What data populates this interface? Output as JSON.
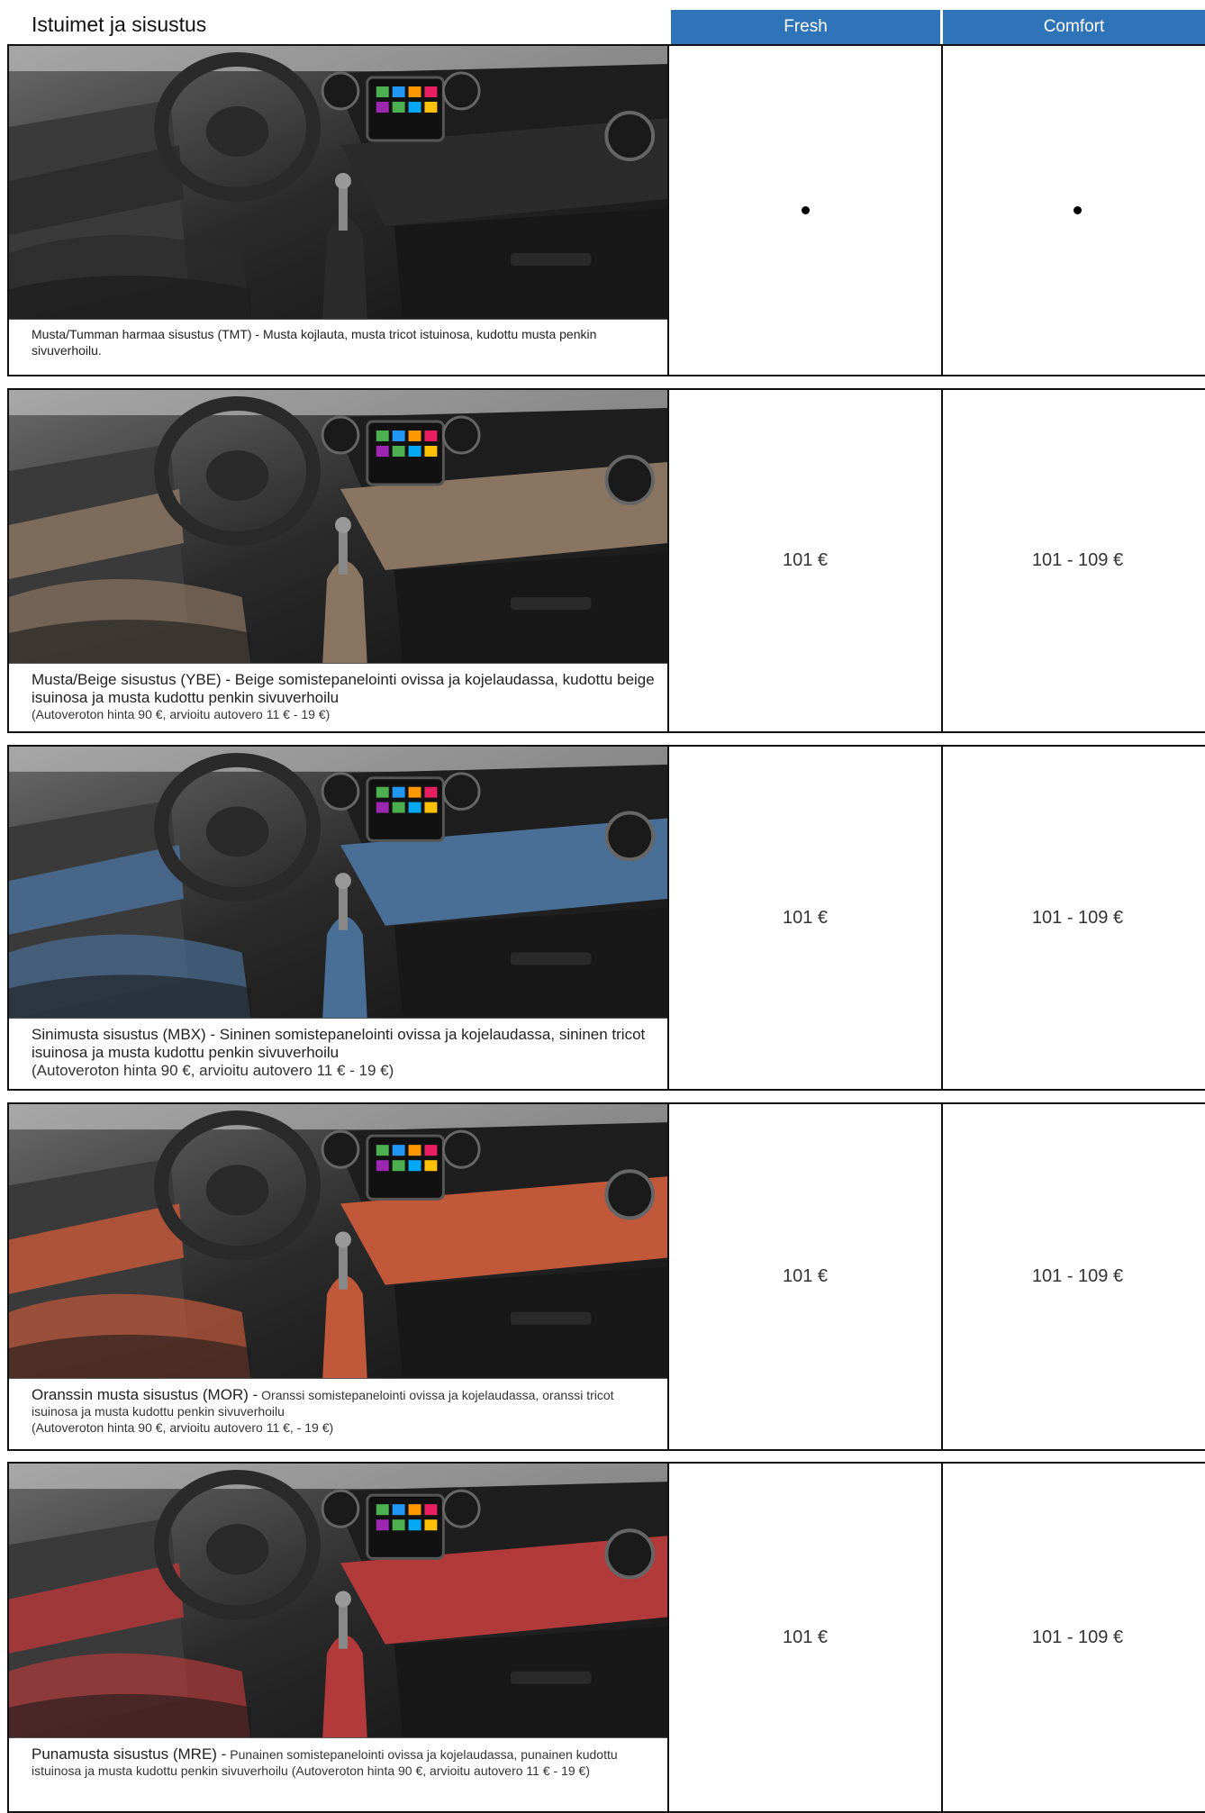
{
  "header": {
    "title": "Istuimet ja sisustus",
    "columns": [
      "Fresh",
      "Comfort"
    ]
  },
  "rows": [
    {
      "accent": "#2b2b2b",
      "desc_main": "Musta/Tumman harmaa sisustus (TMT) - Musta kojlauta, musta tricot istuinosa, kudottu musta penkin sivuverhoilu.",
      "desc_rest": "",
      "desc_note": "",
      "fresh": "",
      "comfort": "",
      "standard": true
    },
    {
      "accent": "#8a7563",
      "desc_main": "Musta/Beige sisustus (YBE) - Beige somistepanelointi ovissa ja kojelaudassa, kudottu beige isuinosa ja musta kudottu penkin sivuverhoilu",
      "desc_rest": "",
      "desc_note": "(Autoveroton hinta 90 €, arvioitu autovero 11 € - 19 €)",
      "fresh": "101 €",
      "comfort": "101 - 109 €",
      "standard": false
    },
    {
      "accent": "#4a6f96",
      "desc_main": "Sinimusta sisustus (MBX) - Sininen somistepanelointi ovissa ja kojelaudassa, sininen tricot isuinosa ja musta kudottu penkin sivuverhoilu",
      "desc_rest": "",
      "desc_note": "(Autoveroton hinta 90 €, arvioitu autovero  11 € - 19 €)",
      "fresh": "101 €",
      "comfort": "101 - 109 €",
      "standard": false
    },
    {
      "accent": "#c2583a",
      "desc_main": "Oranssin musta sisustus (MOR) -",
      "desc_rest": " Oranssi somistepanelointi ovissa ja kojelaudassa, oranssi tricot isuinosa ja musta kudottu penkin sivuverhoilu",
      "desc_note": "(Autoveroton hinta 90 €, arvioitu autovero  11 €, - 19 €)",
      "fresh": "101 €",
      "comfort": "101 - 109 €",
      "standard": false
    },
    {
      "accent": "#b23a3a",
      "desc_main": "Punamusta sisustus (MRE) -",
      "desc_rest": " Punainen somistepanelointi ovissa ja kojelaudassa, punainen kudottu istuinosa ja musta kudottu penkin sivuverhoilu                                (Autoveroton hinta 90 €, arvioitu autovero  11 € - 19 €)",
      "desc_note": "",
      "fresh": "101 €",
      "comfort": "101 - 109 €",
      "standard": false
    }
  ]
}
